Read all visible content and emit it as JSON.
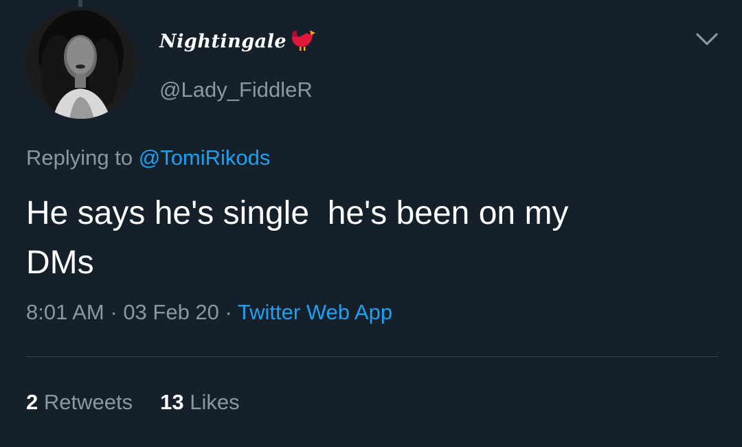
{
  "tweet": {
    "display_name": "Nightingale",
    "handle": "@Lady_FiddleR",
    "reply_prefix": "Replying to",
    "reply_to": "@TomiRikods",
    "text": "He says he's single  he's been on my\nDMs",
    "time": "8:01 AM",
    "sep1": " · ",
    "date": "03 Feb 20",
    "sep2": " · ",
    "source": "Twitter Web App",
    "retweets_count": "2",
    "retweets_label": "Retweets",
    "likes_count": "13",
    "likes_label": "Likes"
  },
  "icons": {
    "bird": "red-bird-emoji",
    "more": "chevron-down-icon"
  },
  "colors": {
    "background": "#15202b",
    "secondary_text": "#8899a6",
    "link": "#1da1f2",
    "divider": "#38444d"
  }
}
